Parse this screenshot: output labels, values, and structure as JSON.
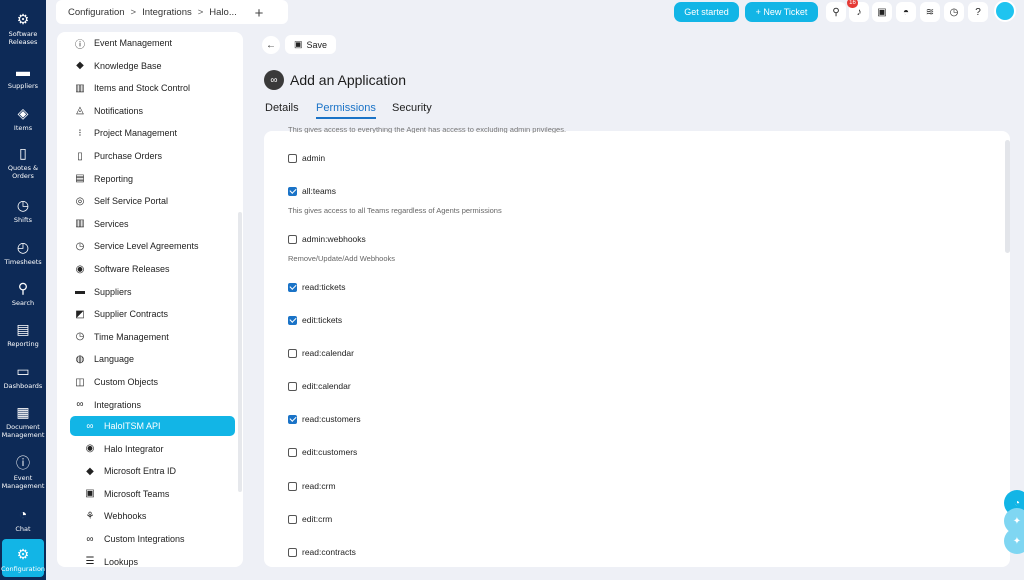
{
  "rail": {
    "items": [
      {
        "label": "Software Releases",
        "icon": "software-releases-icon",
        "glyph": "⚙"
      },
      {
        "label": "Suppliers",
        "icon": "truck-icon",
        "glyph": "▬"
      },
      {
        "label": "Items",
        "icon": "box-icon",
        "glyph": "◈"
      },
      {
        "label": "Quotes & Orders",
        "icon": "document-icon",
        "glyph": "▯"
      },
      {
        "label": "Shifts",
        "icon": "clock-icon",
        "glyph": "◷"
      },
      {
        "label": "Timesheets",
        "icon": "timer-icon",
        "glyph": "◴"
      },
      {
        "label": "Search",
        "icon": "search-icon",
        "glyph": "⚲"
      },
      {
        "label": "Reporting",
        "icon": "report-icon",
        "glyph": "▤"
      },
      {
        "label": "Dashboards",
        "icon": "monitor-icon",
        "glyph": "▭"
      },
      {
        "label": "Document Management",
        "icon": "files-icon",
        "glyph": "▦"
      },
      {
        "label": "Event Management",
        "icon": "alert-icon",
        "glyph": "ⓘ"
      },
      {
        "label": "Chat",
        "icon": "chat-icon",
        "glyph": "◔"
      },
      {
        "label": "Configuration",
        "icon": "gears-icon",
        "glyph": "⚙"
      }
    ]
  },
  "topbar": {
    "breadcrumb": [
      "Configuration",
      "Integrations",
      "Halo..."
    ],
    "breadcrumb_sep": ">",
    "new_tab": "+",
    "get_started": "Get started",
    "new_ticket": "+ New Ticket",
    "notification_count": "16",
    "icons": {
      "search": "⚲",
      "bell": "♪",
      "clipboard": "▣",
      "dashboard": "◓",
      "rss": "≋",
      "history": "◷",
      "help": "?"
    }
  },
  "sidepanel": {
    "items": [
      {
        "label": "Event Management",
        "icon": "alert-icon",
        "glyph": "ⓘ"
      },
      {
        "label": "Knowledge Base",
        "icon": "book-icon",
        "glyph": "◆"
      },
      {
        "label": "Items and Stock Control",
        "icon": "boxes-icon",
        "glyph": "▥"
      },
      {
        "label": "Notifications",
        "icon": "bell-icon",
        "glyph": "◬"
      },
      {
        "label": "Project Management",
        "icon": "project-icon",
        "glyph": "⁝"
      },
      {
        "label": "Purchase Orders",
        "icon": "purchase-order-icon",
        "glyph": "▯"
      },
      {
        "label": "Reporting",
        "icon": "report-icon",
        "glyph": "▤"
      },
      {
        "label": "Self Service Portal",
        "icon": "portal-icon",
        "glyph": "◎"
      },
      {
        "label": "Services",
        "icon": "services-icon",
        "glyph": "▥"
      },
      {
        "label": "Service Level Agreements",
        "icon": "sla-icon",
        "glyph": "◷"
      },
      {
        "label": "Software Releases",
        "icon": "software-icon",
        "glyph": "◉"
      },
      {
        "label": "Suppliers",
        "icon": "truck-icon",
        "glyph": "▬"
      },
      {
        "label": "Supplier Contracts",
        "icon": "contract-icon",
        "glyph": "◩"
      },
      {
        "label": "Time Management",
        "icon": "clock-icon",
        "glyph": "◷"
      },
      {
        "label": "Language",
        "icon": "globe-icon",
        "glyph": "◍"
      },
      {
        "label": "Custom Objects",
        "icon": "objects-icon",
        "glyph": "◫"
      },
      {
        "label": "Integrations",
        "icon": "link-icon",
        "glyph": "∞"
      }
    ],
    "sub_items": [
      {
        "label": "HaloITSM API",
        "icon": "api-icon",
        "glyph": "∞",
        "active": true
      },
      {
        "label": "Halo Integrator",
        "icon": "halo-integrator-icon",
        "glyph": "◉"
      },
      {
        "label": "Microsoft Entra ID",
        "icon": "entra-icon",
        "glyph": "◆"
      },
      {
        "label": "Microsoft Teams",
        "icon": "teams-icon",
        "glyph": "▣"
      },
      {
        "label": "Webhooks",
        "icon": "webhook-icon",
        "glyph": "⚘"
      },
      {
        "label": "Custom Integrations",
        "icon": "link-icon",
        "glyph": "∞"
      },
      {
        "label": "Lookups",
        "icon": "database-icon",
        "glyph": "☰"
      }
    ]
  },
  "main": {
    "back": "←",
    "save": "Save",
    "title": "Add an Application",
    "tabs": [
      {
        "label": "Details",
        "active": false
      },
      {
        "label": "Permissions",
        "active": true
      },
      {
        "label": "Security",
        "active": false
      }
    ],
    "cut_description": "This gives access to everything the Agent has access to excluding admin privileges.",
    "permissions": [
      {
        "label": "admin",
        "checked": false,
        "desc": ""
      },
      {
        "label": "all:teams",
        "checked": true,
        "desc": "This gives access to all Teams regardless of Agents permissions"
      },
      {
        "label": "admin:webhooks",
        "checked": false,
        "desc": "Remove/Update/Add Webhooks"
      },
      {
        "label": "read:tickets",
        "checked": true,
        "desc": ""
      },
      {
        "label": "edit:tickets",
        "checked": true,
        "desc": ""
      },
      {
        "label": "read:calendar",
        "checked": false,
        "desc": ""
      },
      {
        "label": "edit:calendar",
        "checked": false,
        "desc": ""
      },
      {
        "label": "read:customers",
        "checked": true,
        "desc": ""
      },
      {
        "label": "edit:customers",
        "checked": false,
        "desc": ""
      },
      {
        "label": "read:crm",
        "checked": false,
        "desc": ""
      },
      {
        "label": "edit:crm",
        "checked": false,
        "desc": ""
      },
      {
        "label": "read:contracts",
        "checked": false,
        "desc": ""
      }
    ]
  },
  "colors": {
    "accent": "#12b5e6",
    "rail": "#0d2a57",
    "link": "#1a73c7"
  }
}
